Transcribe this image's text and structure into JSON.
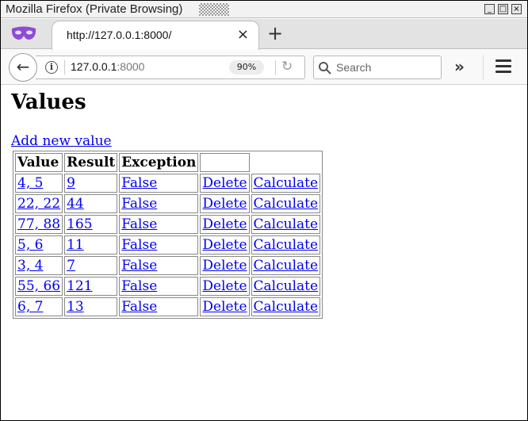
{
  "window": {
    "title": "Mozilla Firefox (Private Browsing)"
  },
  "window_controls": {
    "minimize": "_",
    "maximize": "□",
    "close": "×"
  },
  "tab": {
    "title": "http://127.0.0.1:8000/",
    "close": "×"
  },
  "new_tab": "+",
  "navbar": {
    "back": "←",
    "url_host": "127.0.0.1",
    "url_port": ":8000",
    "zoom": "90%",
    "reload": "↻",
    "search_placeholder": "Search",
    "overflow": "»"
  },
  "page": {
    "title": "Values",
    "add_link": "Add new value",
    "table": {
      "headers": [
        "Value",
        "Result",
        "Exception",
        ""
      ],
      "rows": [
        {
          "value": "4, 5",
          "result": "9",
          "exception": "False",
          "delete": "Delete",
          "calculate": "Calculate"
        },
        {
          "value": "22, 22",
          "result": "44",
          "exception": "False",
          "delete": "Delete",
          "calculate": "Calculate"
        },
        {
          "value": "77, 88",
          "result": "165",
          "exception": "False",
          "delete": "Delete",
          "calculate": "Calculate"
        },
        {
          "value": "5, 6",
          "result": "11",
          "exception": "False",
          "delete": "Delete",
          "calculate": "Calculate"
        },
        {
          "value": "3, 4",
          "result": "7",
          "exception": "False",
          "delete": "Delete",
          "calculate": "Calculate"
        },
        {
          "value": "55, 66",
          "result": "121",
          "exception": "False",
          "delete": "Delete",
          "calculate": "Calculate"
        },
        {
          "value": "6, 7",
          "result": "13",
          "exception": "False",
          "delete": "Delete",
          "calculate": "Calculate"
        }
      ]
    }
  },
  "colors": {
    "link": "#0000ee",
    "mask_icon": "#8f4ad6"
  }
}
